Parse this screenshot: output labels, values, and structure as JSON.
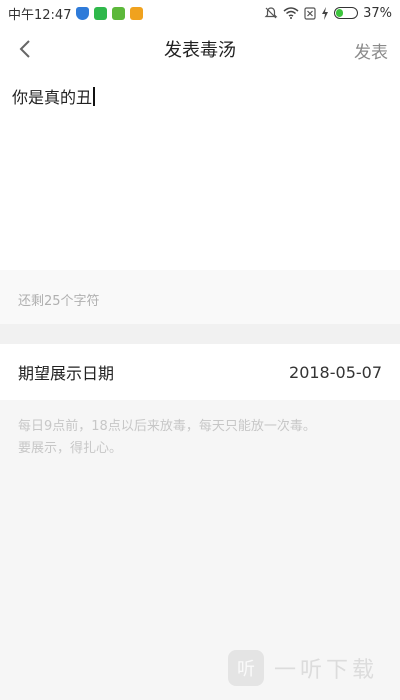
{
  "status_bar": {
    "time": "中午12:47",
    "battery": "37%",
    "battery_level": 0.37,
    "icons": [
      "shield-icon",
      "wechat-icon",
      "app-icon",
      "app-icon",
      "mute-icon",
      "wifi-icon",
      "sim-icon",
      "charging-icon",
      "battery-icon"
    ]
  },
  "header": {
    "title": "发表毒汤",
    "publish_label": "发表",
    "back_icon": "chevron-left-icon"
  },
  "editor": {
    "text": "你是真的丑",
    "counter": "还剩25个字符"
  },
  "date_row": {
    "label": "期望展示日期",
    "value": "2018-05-07"
  },
  "info": {
    "line1": "每日9点前，18点以后来放毒，每天只能放一次毒。",
    "line2": "要展示，得扎心。"
  },
  "watermark": {
    "logo": "听",
    "text": "一听下载"
  },
  "colors": {
    "background": "#f6f6f6",
    "header_bg": "#ffffff",
    "muted_text": "#b0b0b0",
    "publish_text": "#8a8a8a",
    "battery_green": "#3cc43c"
  }
}
